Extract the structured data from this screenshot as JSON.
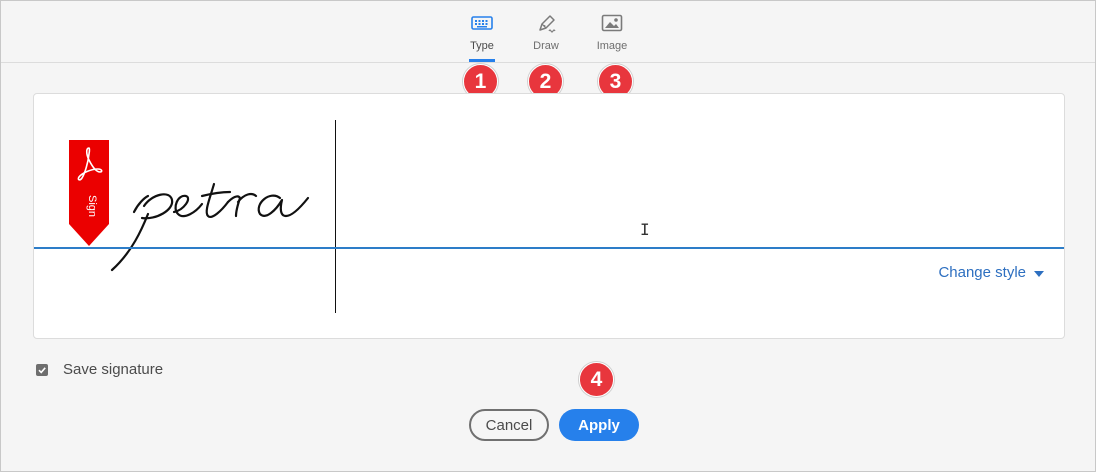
{
  "tabs": [
    {
      "label": "Type",
      "icon": "keyboard-icon",
      "active": true
    },
    {
      "label": "Draw",
      "icon": "pen-icon",
      "active": false
    },
    {
      "label": "Image",
      "icon": "image-icon",
      "active": false
    }
  ],
  "annotations": {
    "badge_1": "1",
    "badge_2": "2",
    "badge_3": "3",
    "badge_4": "4"
  },
  "signature": {
    "typed_text": "petra",
    "sign_flag_label": "Sign",
    "change_style_label": "Change style"
  },
  "save_signature": {
    "label": "Save signature",
    "checked": true
  },
  "actions": {
    "cancel_label": "Cancel",
    "apply_label": "Apply"
  },
  "colors": {
    "accent": "#2680eb",
    "badge": "#e8363d",
    "flag": "#eb0000",
    "baseline": "#2d7dc8"
  }
}
